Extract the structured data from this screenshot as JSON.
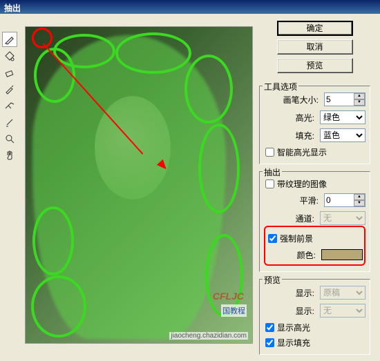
{
  "title": "抽出",
  "buttons": {
    "ok": "确定",
    "cancel": "取消",
    "preview": "预览"
  },
  "tool_options": {
    "title": "工具选项",
    "brush_size_label": "画笔大小:",
    "brush_size": "5",
    "highlight_label": "高光:",
    "highlight_value": "绿色",
    "fill_label": "填充:",
    "fill_value": "蓝色",
    "smart_highlight": "智能高光显示",
    "smart_highlight_checked": false
  },
  "extract": {
    "title": "抽出",
    "textured_label": "带纹理的图像",
    "textured_checked": false,
    "smooth_label": "平滑:",
    "smooth": "0",
    "channel_label": "通道:",
    "channel_value": "无",
    "force_fg_label": "强制前景",
    "force_fg_checked": true,
    "color_label": "颜色:",
    "color_value": "#b8a878"
  },
  "preview": {
    "title": "预览",
    "show_label": "显示:",
    "show_value": "原稿",
    "effect_label": "显示:",
    "effect_value": "无",
    "show_highlight": "显示高光",
    "show_highlight_checked": true,
    "show_fill": "显示填充",
    "show_fill_checked": true
  },
  "tools": [
    {
      "name": "highlighter-icon"
    },
    {
      "name": "fill-icon"
    },
    {
      "name": "eraser-icon"
    },
    {
      "name": "eyedropper-icon"
    },
    {
      "name": "cleanup-icon"
    },
    {
      "name": "edge-touchup-icon"
    },
    {
      "name": "zoom-icon"
    },
    {
      "name": "hand-icon"
    }
  ],
  "watermark": {
    "logo": "CFLJC",
    "tag": "国教程",
    "url": "jiaocheng.chazidian.com"
  }
}
